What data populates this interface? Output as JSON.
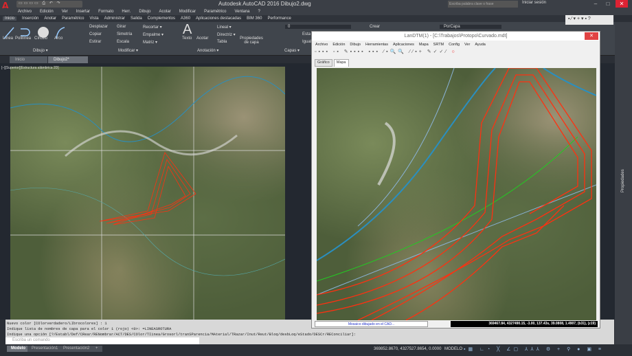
{
  "app": {
    "title": "Autodesk AutoCAD 2016    Dibujo2.dwg",
    "search_placeholder": "Escriba palabra clave o frase",
    "login": "Iniciar sesión",
    "window_controls": [
      "–",
      "□",
      "✕"
    ]
  },
  "menu": [
    "Archivo",
    "Edición",
    "Ver",
    "Insertar",
    "Formato",
    "Herr.",
    "Dibujo",
    "Acotar",
    "Modificar",
    "Paramétrico",
    "Ventana",
    "?"
  ],
  "ribbon_tabs": [
    "Inicio",
    "Inserción",
    "Anotar",
    "Paramétrico",
    "Vista",
    "Administrar",
    "Salida",
    "Complementos",
    "A360",
    "Aplicaciones destacadas",
    "BIM 360",
    "Performance"
  ],
  "ribbon": {
    "dibujo": {
      "items": [
        "Línea",
        "Polilínea",
        "Círculo",
        "Arco"
      ],
      "panel": "Dibujo ▾"
    },
    "modificar": {
      "items": [
        "Desplazar",
        "Girar",
        "Recortar ▾",
        "Copiar",
        "Simetría",
        "Empalme ▾",
        "Estirar",
        "Escala",
        "Matriz ▾"
      ],
      "panel": "Modificar ▾"
    },
    "anotacion": {
      "items": [
        "Texto",
        "Acotar",
        "Lineal ▾",
        "Directriz ▾",
        "Tabla"
      ],
      "panel": "Anotación ▾"
    },
    "capas": {
      "items": [
        "Propiedades de capa",
        "0",
        "Esta",
        "Igual"
      ],
      "panel": "Capas ▾"
    },
    "bloque": {
      "items": [
        "Crear"
      ]
    },
    "propiedades": {
      "items": [
        "PorCapa"
      ]
    }
  },
  "doc_tabs": [
    "Inicio",
    "Dibujo2*"
  ],
  "viewport_label": "[–][Superior][Estructura alámbrica 2D]",
  "command": {
    "lines": [
      "Nuevo color [COlorverdadero/LIbrocolores] : 1",
      "Indique lista de nombres de capa para el color 1 (rojo) <0>: =LINEASROTURA",
      "Indique una opción [?/Establ/Def/CRear/RENombrar/ACT/DES/COlor/TIinea/Grosorl/tranSParencia/MAterial/TRazar/Inut/Reut/Bloq/desbLoq/eStado/DESCr/REConciliar]:"
    ],
    "placeholder": "Escriba un comando"
  },
  "layout_tabs": [
    "Modelo",
    "Presentación1",
    "Presentación2",
    "+"
  ],
  "status": {
    "coords": "369852.8670, 4327527.8654, 0.0000",
    "mode": "MODELO"
  },
  "properties_palette": "Propiedades",
  "landtm": {
    "title": "LanDTM(1) - [C:\\Trabajos\\Protopo\\Curvado.mdt]",
    "menu": [
      "Archivo",
      "Edición",
      "Dibujo",
      "Herramientas",
      "Aplicaciones",
      "Mapa",
      "SRTM",
      "Config",
      "Ver",
      "Ayuda"
    ],
    "tabs": [
      "Gráfico",
      "Mapa"
    ],
    "active_tab": "Mapa",
    "status": "Mosaico dibujado en el CAD...",
    "coords": "369467.84, 4327490.15, -3.00, 137.43s, 39.0808, 1.4907, (b31), (z19)"
  },
  "colors": {
    "contour": "#ff3010",
    "accent": "#e0262b",
    "water": "#2a8fc0",
    "boundary": "#8ab3d8",
    "road": "#22cc22"
  }
}
